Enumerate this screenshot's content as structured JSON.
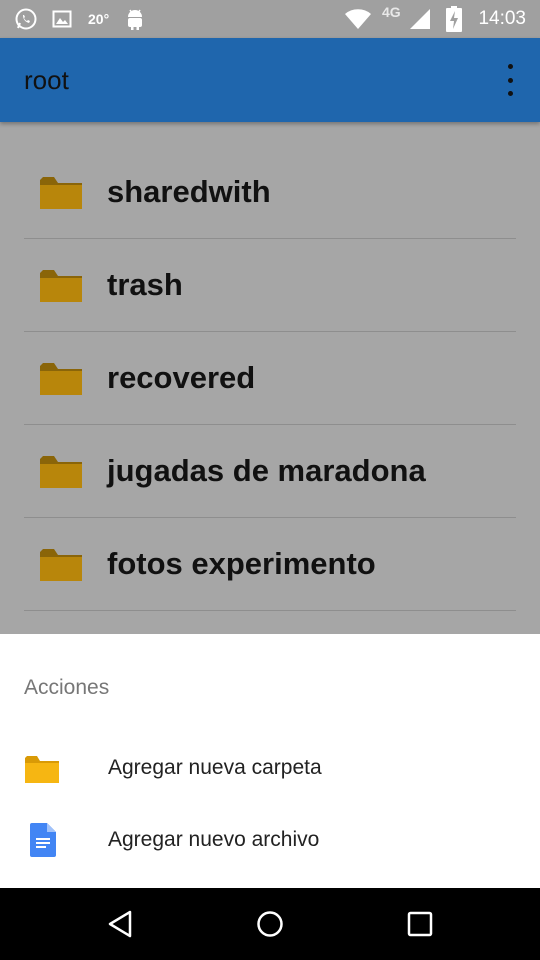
{
  "status_bar": {
    "temperature": "20°",
    "network": "4G",
    "time": "14:03",
    "icons": [
      "whatsapp-icon",
      "image-icon",
      "android-icon",
      "wifi-icon",
      "signal-icon",
      "battery-charging-icon"
    ]
  },
  "app_bar": {
    "title": "root",
    "overflow_icon": "more-vert-icon"
  },
  "folders": [
    {
      "label": "sharedwith",
      "icon": "folder-icon"
    },
    {
      "label": "trash",
      "icon": "folder-icon"
    },
    {
      "label": "recovered",
      "icon": "folder-icon"
    },
    {
      "label": "jugadas de maradona",
      "icon": "folder-icon"
    },
    {
      "label": "fotos experimento",
      "icon": "folder-icon"
    }
  ],
  "bottom_sheet": {
    "title": "Acciones",
    "items": [
      {
        "label": "Agregar nueva carpeta",
        "icon": "folder-icon"
      },
      {
        "label": "Agregar nuevo archivo",
        "icon": "document-icon"
      }
    ]
  },
  "nav_bar": {
    "buttons": [
      "back-icon",
      "home-icon",
      "recents-icon"
    ]
  },
  "colors": {
    "app_bar": "#1f66ad",
    "scrim_background": "#a6a6a6",
    "folder": "#b8860b",
    "document": "#4285f4",
    "nav_bar": "#000000"
  }
}
